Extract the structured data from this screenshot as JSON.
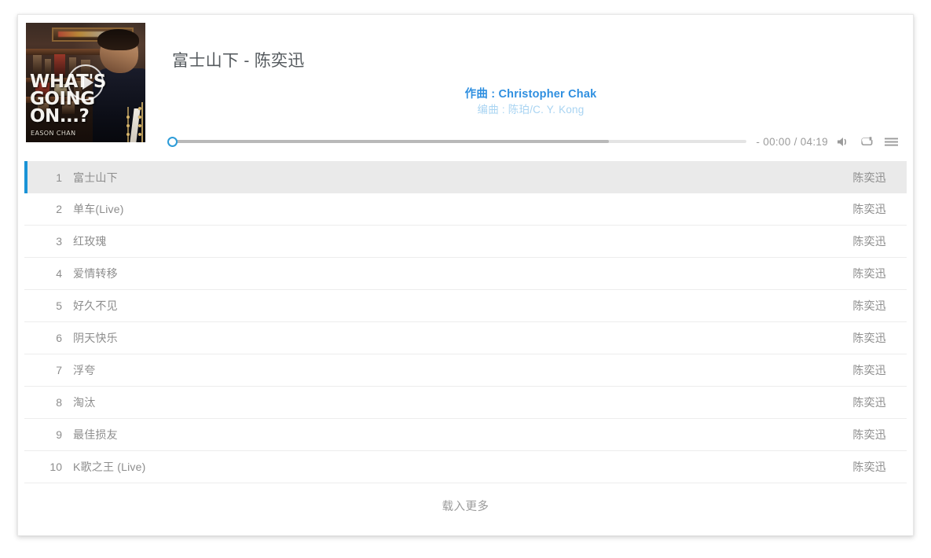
{
  "player": {
    "song_title": "富士山下 - 陈奕迅",
    "composer_line": "作曲 : Christopher Chak",
    "arranger_line": "编曲 : 陈珀/C. Y. Kong",
    "time_display": "- 00:00 / 04:19",
    "current_time": "00:00",
    "total_time": "04:19",
    "progress_percent": 0,
    "loaded_percent": 75,
    "cover": {
      "title_line1": "WHAT'S",
      "title_line2": "GOING ON...?",
      "artist_credit": "EASON CHAN"
    },
    "icons": {
      "play": "play-icon",
      "volume": "volume-icon",
      "repeat": "repeat-icon",
      "playlist": "playlist-icon"
    },
    "accent_color": "#1a93d6",
    "meta_color": "#2f8fe0"
  },
  "tracks": [
    {
      "index": "1",
      "name": "富士山下",
      "artist": "陈奕迅",
      "active": true
    },
    {
      "index": "2",
      "name": "单车(Live)",
      "artist": "陈奕迅",
      "active": false
    },
    {
      "index": "3",
      "name": "红玫瑰",
      "artist": "陈奕迅",
      "active": false
    },
    {
      "index": "4",
      "name": "爱情转移",
      "artist": "陈奕迅",
      "active": false
    },
    {
      "index": "5",
      "name": "好久不见",
      "artist": "陈奕迅",
      "active": false
    },
    {
      "index": "6",
      "name": "阴天快乐",
      "artist": "陈奕迅",
      "active": false
    },
    {
      "index": "7",
      "name": "浮夸",
      "artist": "陈奕迅",
      "active": false
    },
    {
      "index": "8",
      "name": "淘汰",
      "artist": "陈奕迅",
      "active": false
    },
    {
      "index": "9",
      "name": "最佳损友",
      "artist": "陈奕迅",
      "active": false
    },
    {
      "index": "10",
      "name": "K歌之王 (Live)",
      "artist": "陈奕迅",
      "active": false
    }
  ],
  "footer": {
    "load_more_label": "载入更多"
  }
}
